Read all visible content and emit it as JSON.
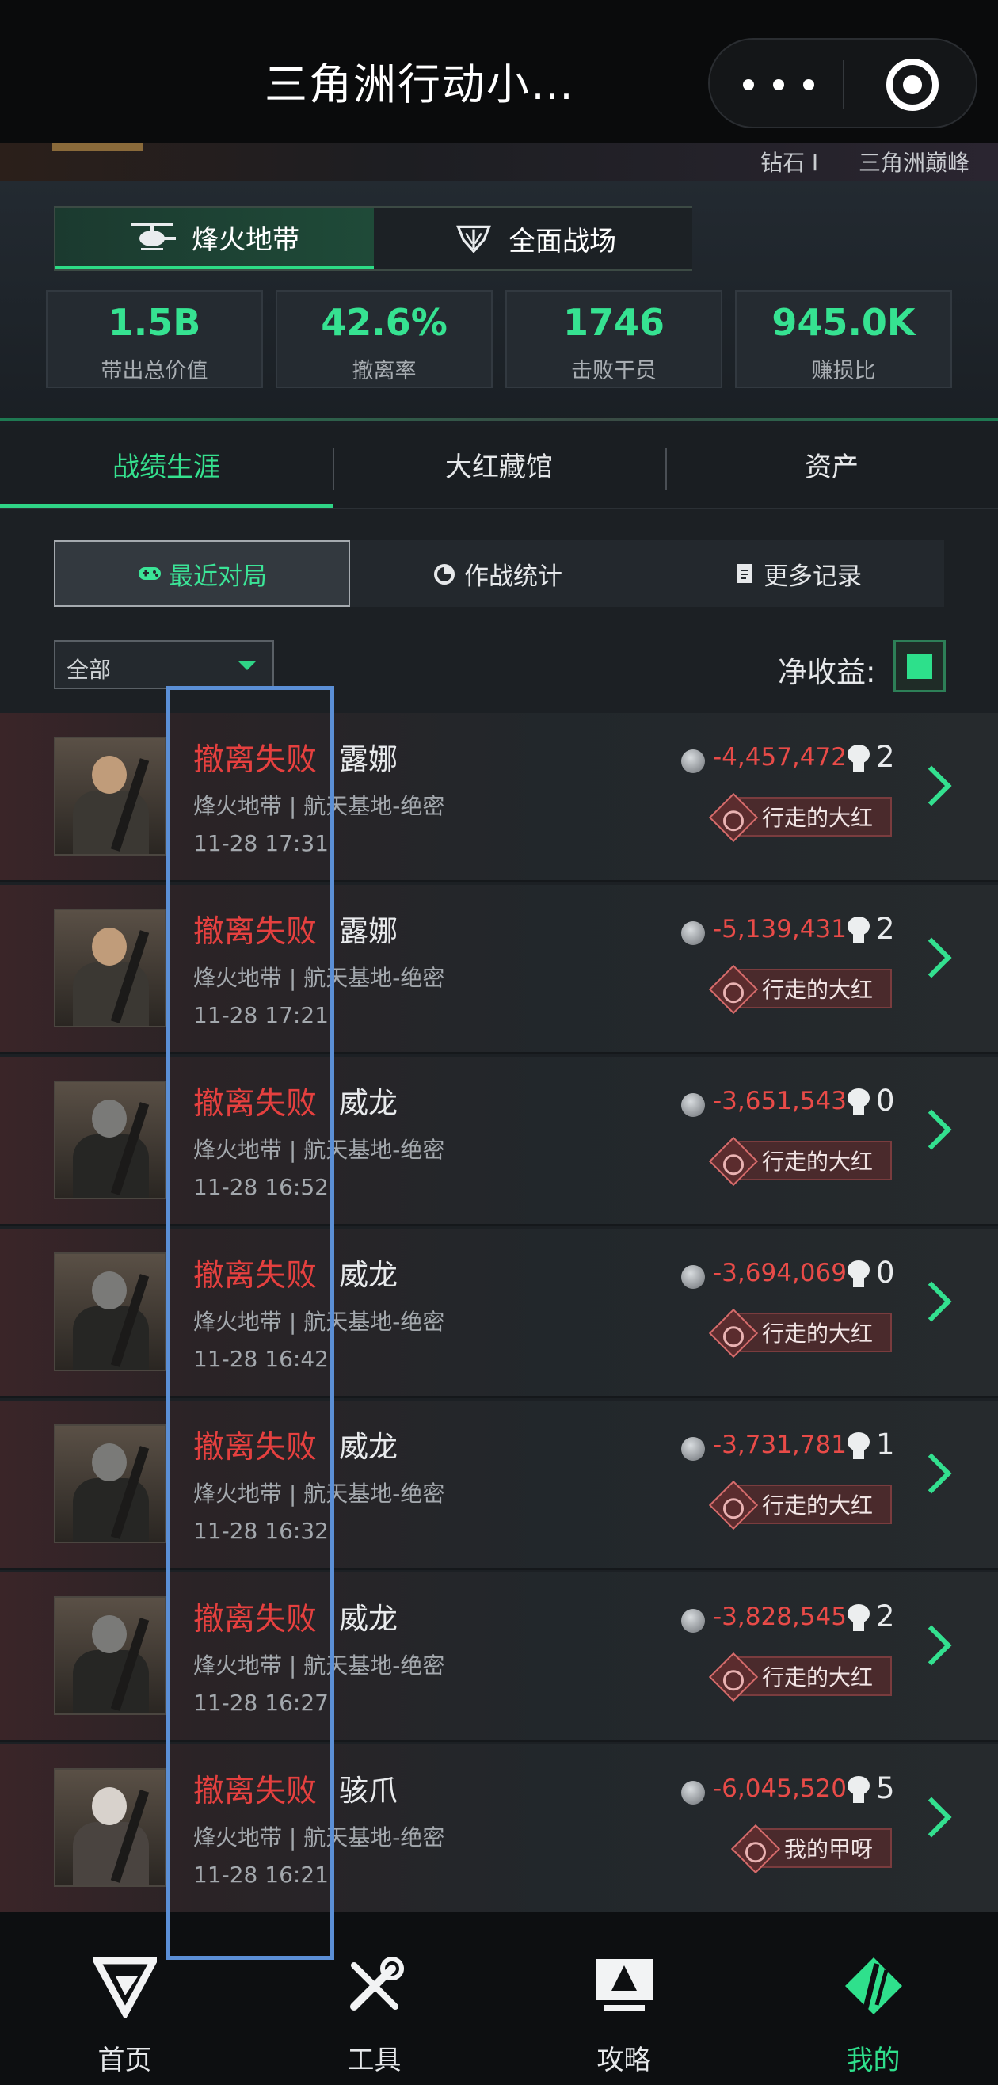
{
  "titlebar": {
    "title": "三角洲行动小…"
  },
  "profile": {
    "rank": "钻石 I",
    "rank2": "三角洲巅峰"
  },
  "modes": [
    {
      "label": "烽火地带",
      "icon": "helicopter-icon",
      "active": true
    },
    {
      "label": "全面战场",
      "icon": "faction-emblem-icon",
      "active": false
    }
  ],
  "stats": [
    {
      "value": "1.5B",
      "label": "带出总价值"
    },
    {
      "value": "42.6%",
      "label": "撤离率"
    },
    {
      "value": "1746",
      "label": "击败干员"
    },
    {
      "value": "945.0K",
      "label": "赚损比"
    }
  ],
  "main_tabs": [
    {
      "label": "战绩生涯",
      "active": true
    },
    {
      "label": "大红藏馆",
      "active": false
    },
    {
      "label": "资产",
      "active": false
    }
  ],
  "sub_tabs": [
    {
      "label": "最近对局",
      "icon": "gamepad-icon",
      "active": true
    },
    {
      "label": "作战统计",
      "icon": "pie-chart-icon",
      "active": false
    },
    {
      "label": "更多记录",
      "icon": "document-icon",
      "active": false
    }
  ],
  "filter": {
    "selected": "全部"
  },
  "net_income": {
    "label": "净收益:",
    "checked": true
  },
  "matches": [
    {
      "result": "撤离失败",
      "operator": "露娜",
      "map": "烽火地带 | 航天基地-绝密",
      "time": "11-28 17:31",
      "value": "-4,457,472",
      "kills": "2",
      "badge": "行走的大红",
      "avatar": "luna"
    },
    {
      "result": "撤离失败",
      "operator": "露娜",
      "map": "烽火地带 | 航天基地-绝密",
      "time": "11-28 17:21",
      "value": "-5,139,431",
      "kills": "2",
      "badge": "行走的大红",
      "avatar": "luna"
    },
    {
      "result": "撤离失败",
      "operator": "威龙",
      "map": "烽火地带 | 航天基地-绝密",
      "time": "11-28 16:52",
      "value": "-3,651,543",
      "kills": "0",
      "badge": "行走的大红",
      "avatar": "ops"
    },
    {
      "result": "撤离失败",
      "operator": "威龙",
      "map": "烽火地带 | 航天基地-绝密",
      "time": "11-28 16:42",
      "value": "-3,694,069",
      "kills": "0",
      "badge": "行走的大红",
      "avatar": "ops"
    },
    {
      "result": "撤离失败",
      "operator": "威龙",
      "map": "烽火地带 | 航天基地-绝密",
      "time": "11-28 16:32",
      "value": "-3,731,781",
      "kills": "1",
      "badge": "行走的大红",
      "avatar": "ops"
    },
    {
      "result": "撤离失败",
      "operator": "威龙",
      "map": "烽火地带 | 航天基地-绝密",
      "time": "11-28 16:27",
      "value": "-3,828,545",
      "kills": "2",
      "badge": "行走的大红",
      "avatar": "ops"
    },
    {
      "result": "撤离失败",
      "operator": "骇爪",
      "map": "烽火地带 | 航天基地-绝密",
      "time": "11-28 16:21",
      "value": "-6,045,520",
      "kills": "5",
      "badge": "我的甲呀",
      "avatar": "claw"
    }
  ],
  "bottom_nav": [
    {
      "label": "首页",
      "icon": "home-logo-icon",
      "active": false
    },
    {
      "label": "工具",
      "icon": "tools-icon",
      "active": false
    },
    {
      "label": "攻略",
      "icon": "guide-monitor-icon",
      "active": false
    },
    {
      "label": "我的",
      "icon": "profile-logo-icon",
      "active": true
    }
  ],
  "colors": {
    "accent": "#2fd486",
    "loss": "#e5403f",
    "highlight": "#5b8fd6"
  }
}
